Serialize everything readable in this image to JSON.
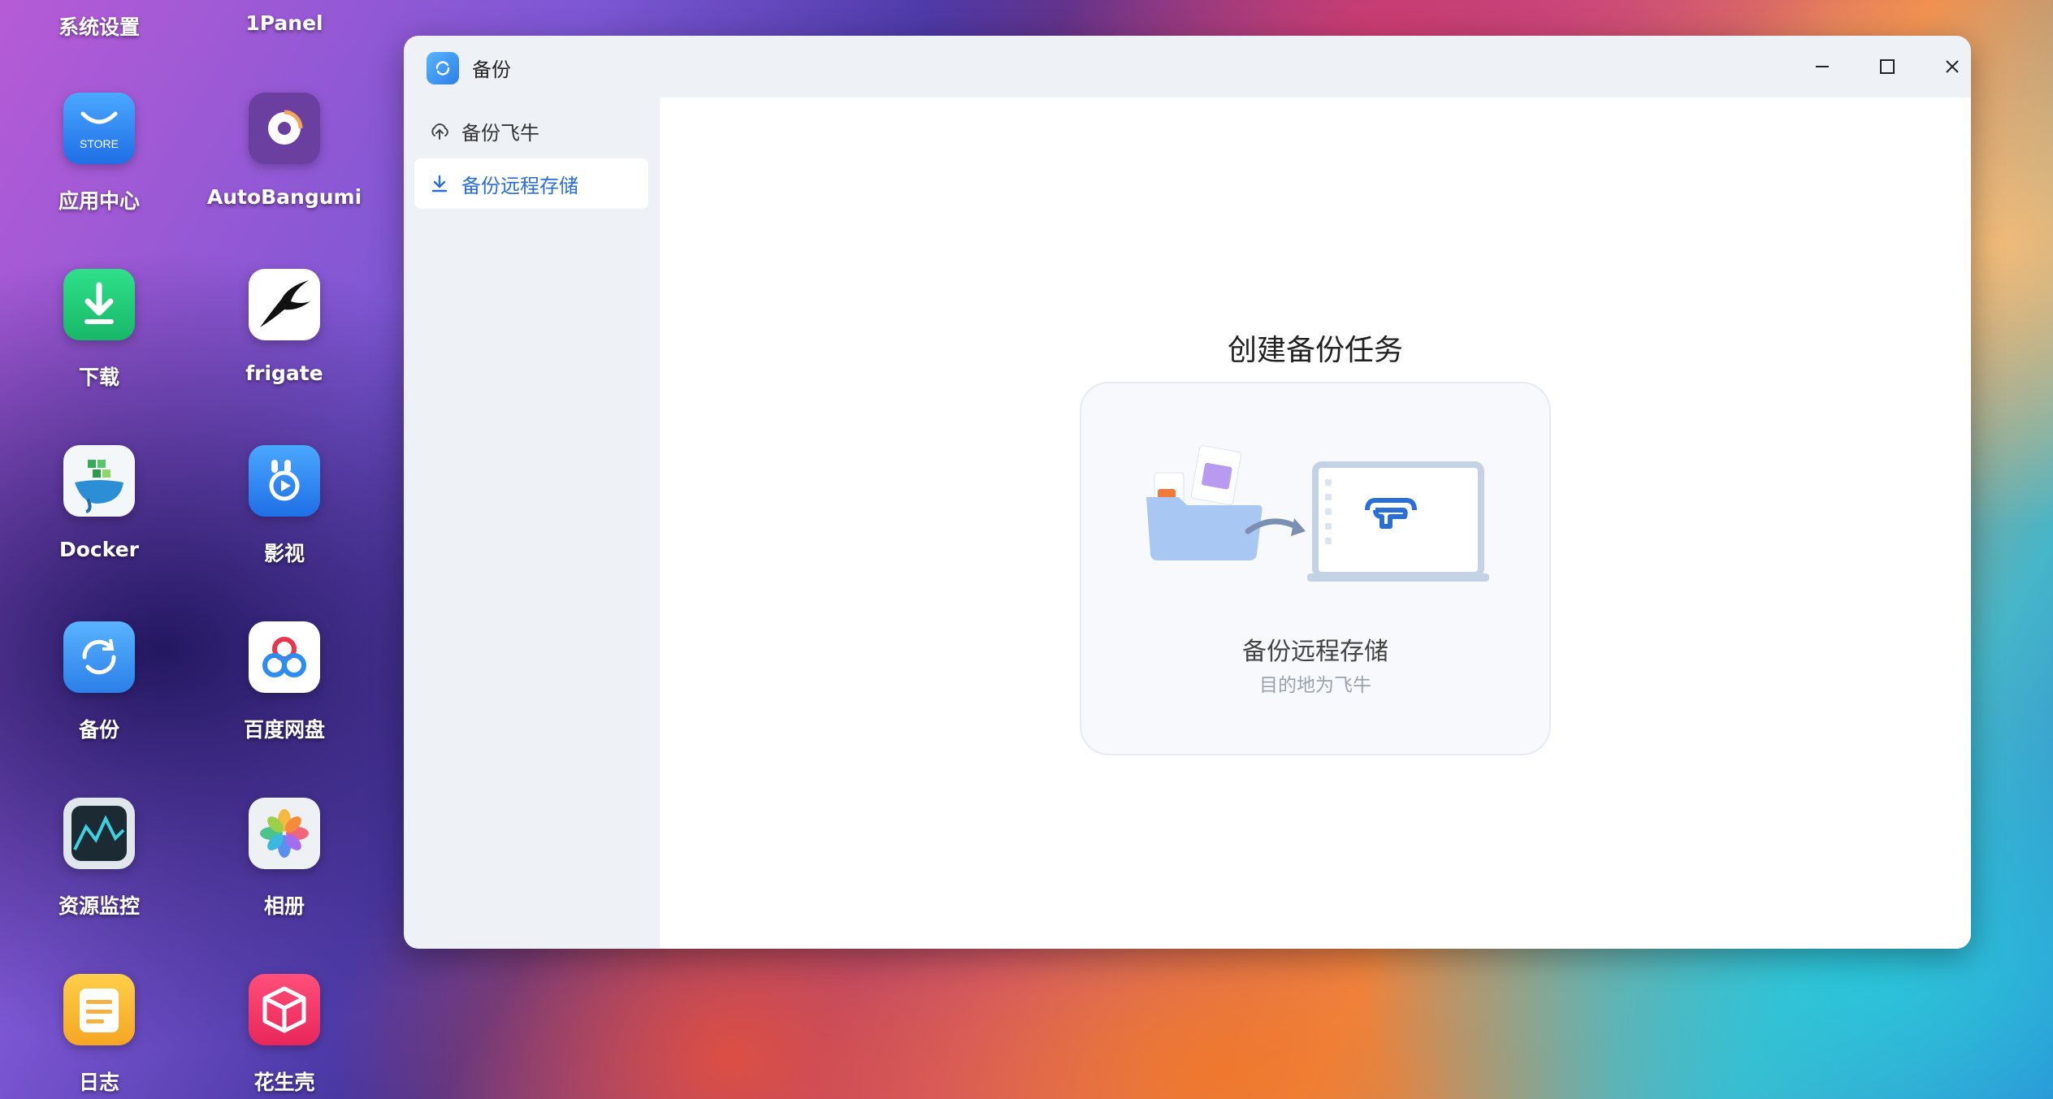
{
  "desktop": {
    "top_labels": [
      "系统设置",
      "1Panel"
    ],
    "icons": [
      {
        "label": "应用中心",
        "store_text": "STORE"
      },
      {
        "label": "AutoBangumi"
      },
      {
        "label": "下载"
      },
      {
        "label": "frigate"
      },
      {
        "label": "Docker"
      },
      {
        "label": "影视"
      },
      {
        "label": "备份"
      },
      {
        "label": "百度网盘"
      },
      {
        "label": "资源监控"
      },
      {
        "label": "相册"
      },
      {
        "label": "日志"
      },
      {
        "label": "花生壳"
      }
    ]
  },
  "window": {
    "title": "备份",
    "sidebar": {
      "items": [
        {
          "label": "备份飞牛",
          "icon": "cloud-upload-icon",
          "active": false
        },
        {
          "label": "备份远程存储",
          "icon": "download-icon",
          "active": true
        }
      ]
    },
    "main": {
      "heading": "创建备份任务",
      "card": {
        "title": "备份远程存储",
        "subtitle": "目的地为飞牛"
      }
    }
  },
  "colors": {
    "accent": "#2a6fd6",
    "window_bg": "#eef2f7",
    "card_bg": "#f7f9fc"
  }
}
